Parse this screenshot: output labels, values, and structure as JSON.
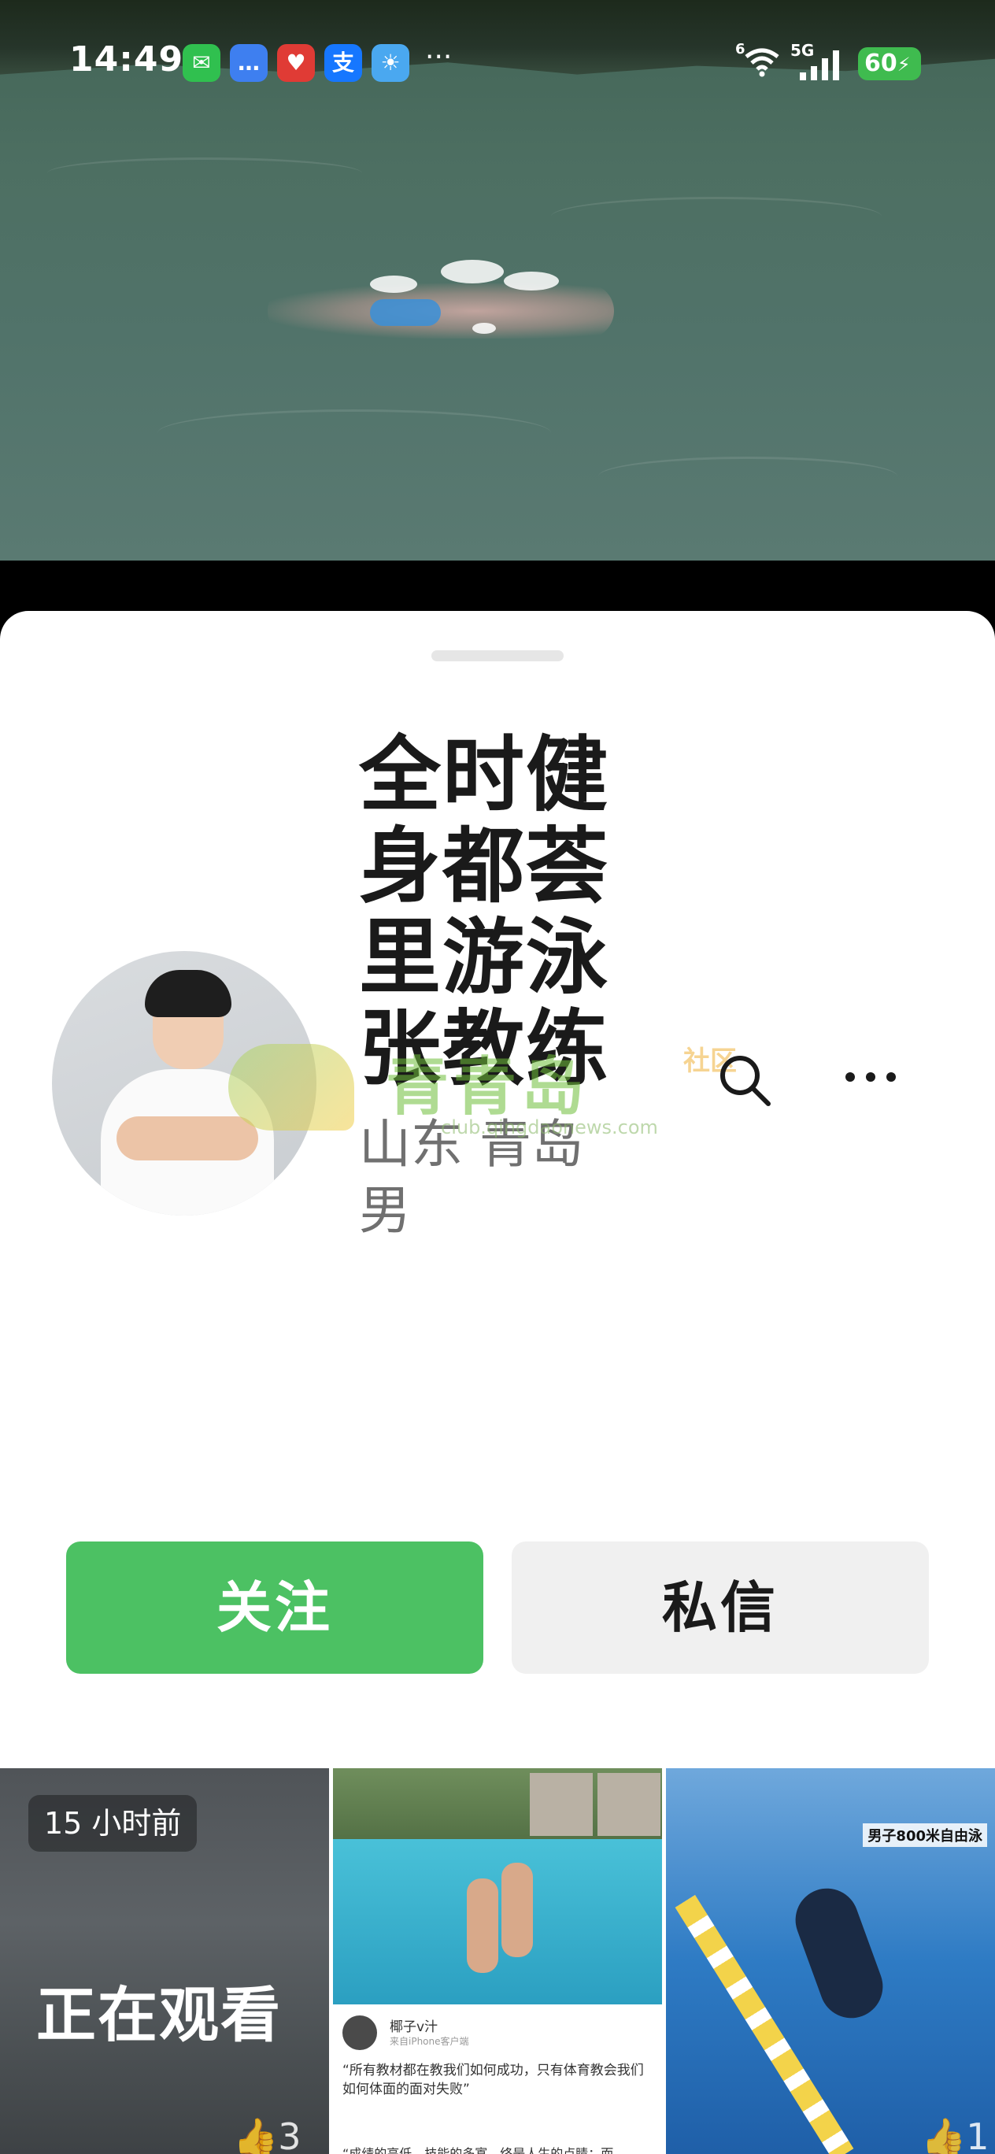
{
  "status_bar": {
    "time": "14:49",
    "more": "···",
    "network_1": "6",
    "network_2": "5G",
    "battery": "60"
  },
  "profile": {
    "name_lines": [
      "全时健",
      "身都荟",
      "里游泳",
      "张教练"
    ],
    "location": "山东 青岛",
    "gender": "男"
  },
  "watermark": {
    "brand": "青青岛",
    "tag": "社区",
    "url": "club.qingdaonews.com"
  },
  "actions": {
    "follow_label": "关注",
    "message_label": "私信"
  },
  "thumbnails": [
    {
      "time_badge": "15 小时前",
      "label": "正在观看",
      "likes": "3"
    },
    {
      "post_name": "椰子v汁",
      "post_sub": "来自iPhone客户端",
      "post_text": "“所有教材都在教我们如何成功，只有体育教会我们如何体面的面对失败”",
      "post_text2": "“成绩的高低，技能的多寡，终是人生的点睛；而"
    },
    {
      "caption": "男子800米自由泳",
      "likes": "1"
    }
  ],
  "colors": {
    "follow_green": "#4cc163",
    "message_gray": "#f0f0f0",
    "name_text": "#1a1a1a",
    "meta_text": "#707070"
  }
}
